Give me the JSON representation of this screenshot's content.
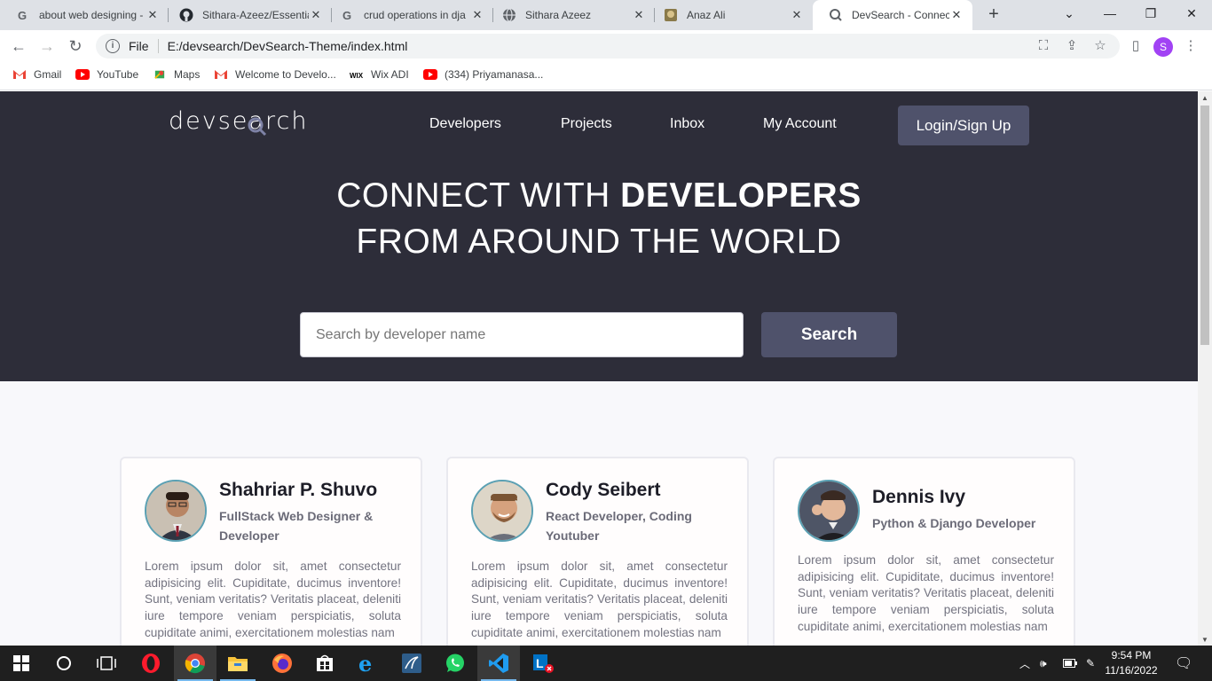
{
  "browser": {
    "tabs": [
      {
        "title": "about web designing - ",
        "favicon": "google-icon",
        "active": false
      },
      {
        "title": "Sithara-Azeez/Essentia",
        "favicon": "github-icon",
        "active": false
      },
      {
        "title": "crud operations in dja",
        "favicon": "google-icon",
        "active": false
      },
      {
        "title": "Sithara Azeez",
        "favicon": "globe-icon",
        "active": false
      },
      {
        "title": "Anaz Ali",
        "favicon": "site-icon",
        "active": false
      },
      {
        "title": "DevSearch - Connect",
        "favicon": "devsearch-icon",
        "active": true
      }
    ],
    "address": {
      "scheme": "File",
      "url": "E:/devsearch/DevSearch-Theme/index.html"
    },
    "profile_initial": "S",
    "bookmarks": [
      {
        "label": "Gmail",
        "icon": "gmail-icon"
      },
      {
        "label": "YouTube",
        "icon": "youtube-icon"
      },
      {
        "label": "Maps",
        "icon": "maps-icon"
      },
      {
        "label": "Welcome to Develo...",
        "icon": "gmail-icon"
      },
      {
        "label": "Wix ADI",
        "icon": "wix-icon"
      },
      {
        "label": "(334) Priyamanasa...",
        "icon": "youtube-icon"
      }
    ]
  },
  "site": {
    "logo": {
      "left": "devse",
      "mid": "a",
      "right": "rch"
    },
    "nav": [
      "Developers",
      "Projects",
      "Inbox",
      "My Account"
    ],
    "login_label": "Login/Sign Up",
    "headline": {
      "line1_light": "CONNECT WITH ",
      "line1_bold": "DEVELOPERS",
      "line2": "FROM AROUND THE WORLD"
    },
    "search": {
      "placeholder": "Search by developer name",
      "button": "Search"
    },
    "developers": [
      {
        "name": "Shahriar P. Shuvo",
        "role": "FullStack Web Designer & Developer",
        "bio": "Lorem ipsum dolor sit, amet consectetur adipisicing elit. Cupiditate, ducimus inventore! Sunt, veniam veritatis? Veritatis placeat, deleniti iure tempore veniam perspiciatis, soluta cupiditate animi, exercitationem molestias nam"
      },
      {
        "name": "Cody Seibert",
        "role": "React Developer, Coding Youtuber",
        "bio": "Lorem ipsum dolor sit, amet consectetur adipisicing elit. Cupiditate, ducimus inventore! Sunt, veniam veritatis? Veritatis placeat, deleniti iure tempore veniam perspiciatis, soluta cupiditate animi, exercitationem molestias nam"
      },
      {
        "name": "Dennis Ivy",
        "role": "Python & Django Developer",
        "bio": "Lorem ipsum dolor sit, amet consectetur adipisicing elit. Cupiditate, ducimus inventore! Sunt, veniam veritatis? Veritatis placeat, deleniti iure tempore veniam perspiciatis, soluta cupiditate animi, exercitationem molestias nam"
      }
    ]
  },
  "taskbar": {
    "time": "9:54 PM",
    "date": "11/16/2022",
    "apps": [
      "start-icon",
      "search-icon",
      "task-view-icon",
      "opera-icon",
      "chrome-icon",
      "file-explorer-icon",
      "firefox-icon",
      "store-icon",
      "edge-icon",
      "mysql-icon",
      "whatsapp-icon",
      "vscode-icon",
      "lync-icon"
    ]
  },
  "colors": {
    "hero_bg": "#2d2d39",
    "button_bg": "#4f526b",
    "page_bg": "#f8f8fb"
  }
}
